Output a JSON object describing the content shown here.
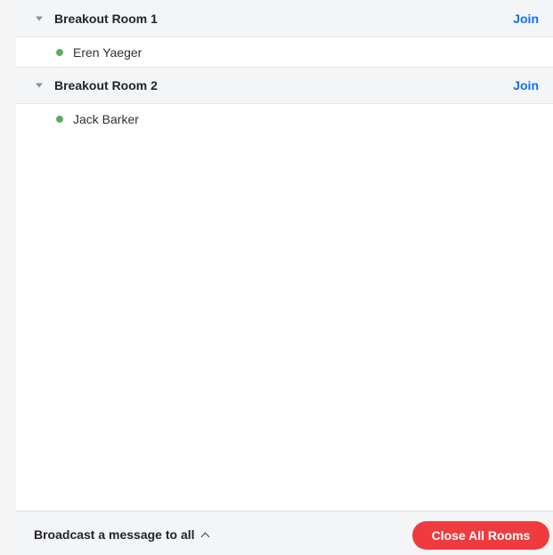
{
  "rooms": [
    {
      "title": "Breakout Room 1",
      "join_label": "Join",
      "participants": [
        {
          "name": "Eren Yaeger",
          "status_color": "#5fae5f"
        }
      ]
    },
    {
      "title": "Breakout Room 2",
      "join_label": "Join",
      "participants": [
        {
          "name": "Jack Barker",
          "status_color": "#5fae5f"
        }
      ]
    }
  ],
  "footer": {
    "broadcast_label": "Broadcast a message to all",
    "broadcast_icon": "chevron-up-icon",
    "close_all_label": "Close All Rooms"
  },
  "colors": {
    "accent": "#0e72ed",
    "danger": "#ef3b3e",
    "online": "#5fae5f"
  }
}
